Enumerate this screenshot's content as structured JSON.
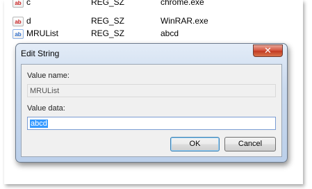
{
  "registry_list": {
    "rows": [
      {
        "icon": "ab",
        "name": "c",
        "type": "REG_SZ",
        "data": "chrome.exe"
      },
      {
        "icon": "ab",
        "name": "d",
        "type": "REG_SZ",
        "data": "WinRAR.exe"
      },
      {
        "icon": "ab",
        "name": "MRUList",
        "type": "REG_SZ",
        "data": "abcd"
      }
    ]
  },
  "dialog": {
    "title": "Edit String",
    "close_symbol": "✕",
    "value_name_label": "Value name:",
    "value_name": "MRUList",
    "value_data_label": "Value data:",
    "value_data": "abcd",
    "ok_label": "OK",
    "cancel_label": "Cancel"
  },
  "colors": {
    "selection": "#3399ff",
    "close_button": "#c23a22",
    "dialog_frame": "#c9d9ee"
  }
}
